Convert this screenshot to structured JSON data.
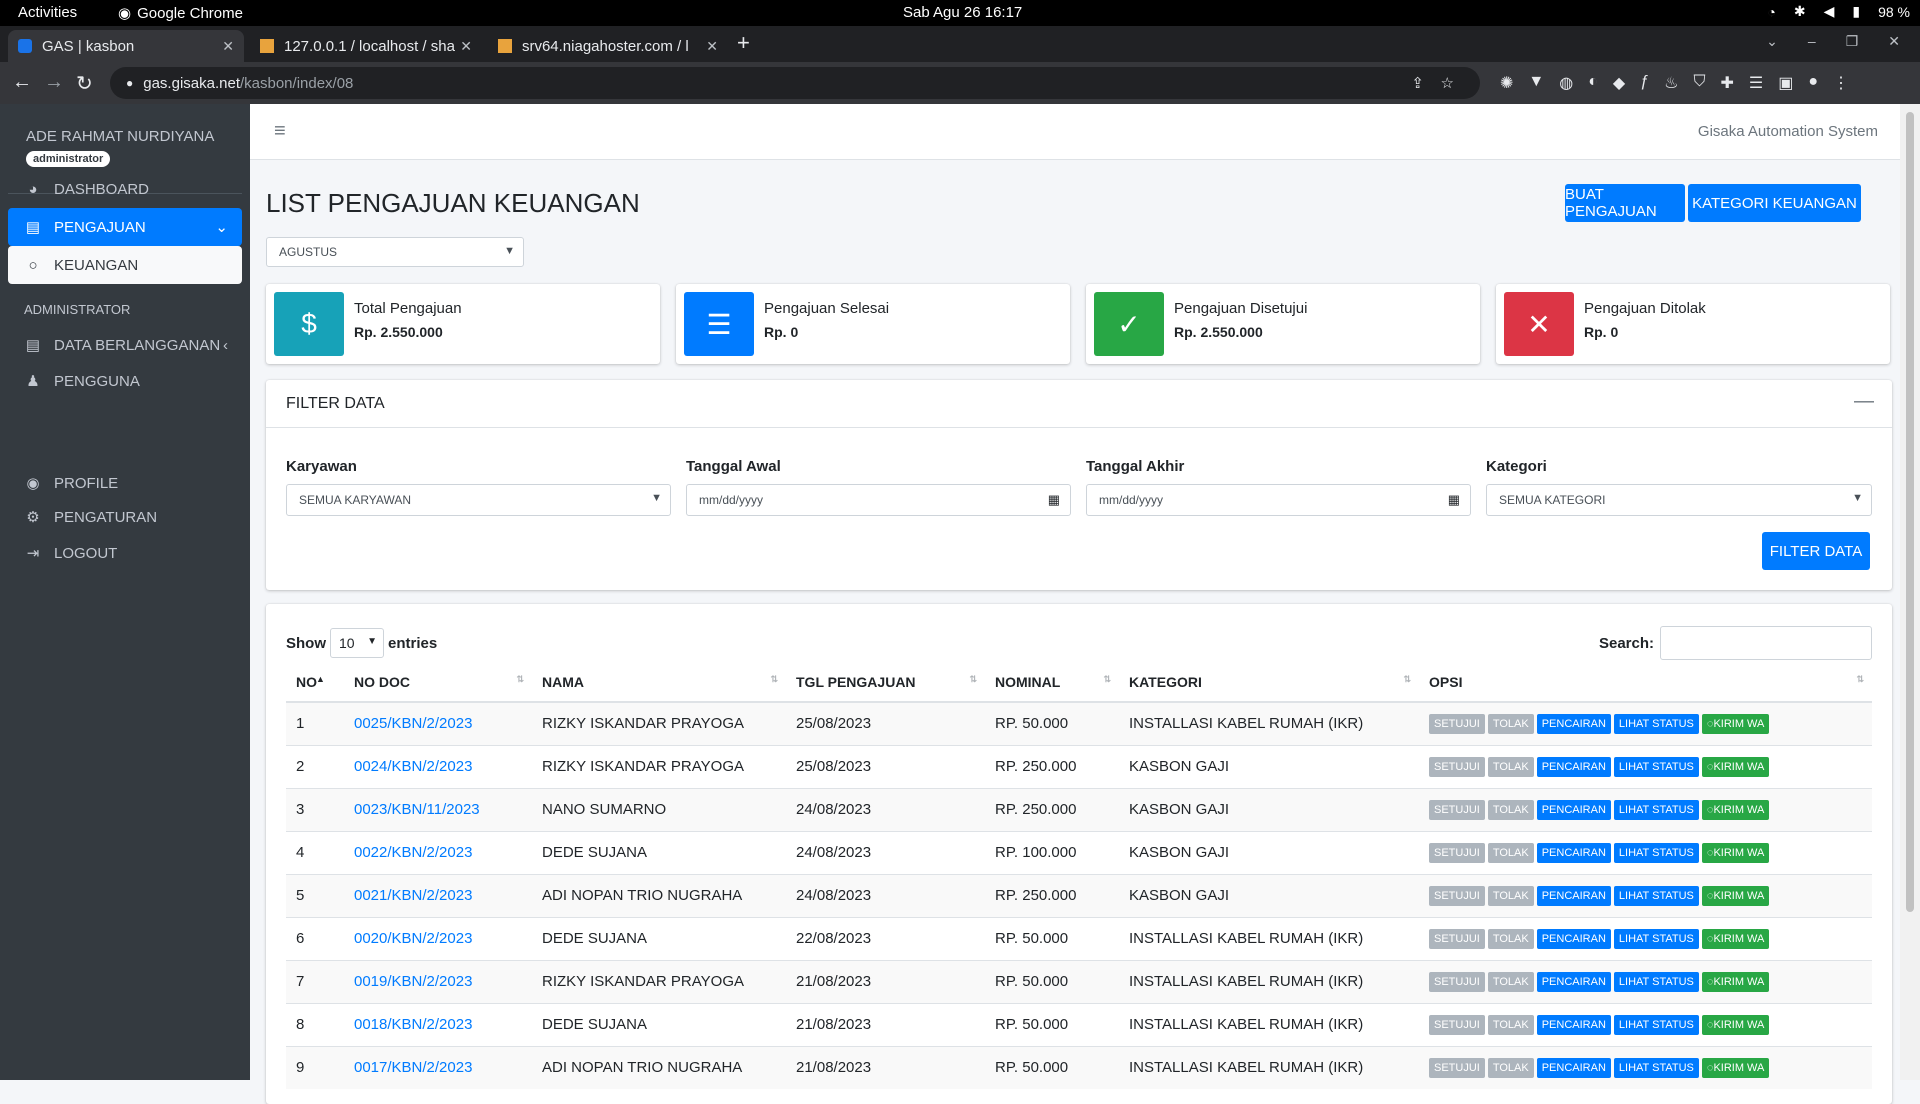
{
  "os": {
    "activities": "Activities",
    "app": "Google Chrome",
    "clock": "Sab Agu 26  16:17",
    "battery": "98 %"
  },
  "browser": {
    "tabs": [
      {
        "title": "GAS | kasbon"
      },
      {
        "title": "127.0.0.1 / localhost / sha"
      },
      {
        "title": "srv64.niagahoster.com / l"
      }
    ],
    "url_host": "gas.gisaka.net",
    "url_path": "/kasbon/index/08"
  },
  "sidebar": {
    "user_name": "ADE RAHMAT NURDIYANA",
    "role": "administrator",
    "items": [
      {
        "label": "DASHBOARD"
      },
      {
        "label": "PENGAJUAN"
      },
      {
        "label": "KEUANGAN"
      }
    ],
    "admin_header": "ADMINISTRATOR",
    "admin_items": [
      {
        "label": "DATA BERLANGGANAN"
      },
      {
        "label": "PENGGUNA"
      }
    ],
    "bottom_items": [
      {
        "label": "PROFILE"
      },
      {
        "label": "PENGATURAN"
      },
      {
        "label": "LOGOUT"
      }
    ]
  },
  "header": {
    "brand": "Gisaka Automation System"
  },
  "page": {
    "title": "LIST PENGAJUAN KEUANGAN",
    "btn_create": "BUAT PENGAJUAN",
    "btn_category": "KATEGORI KEUANGAN",
    "month": "AGUSTUS"
  },
  "stats": [
    {
      "label": "Total Pengajuan",
      "value": "Rp. 2.550.000",
      "color": "#17a2b8"
    },
    {
      "label": "Pengajuan Selesai",
      "value": "Rp. 0",
      "color": "#007bff"
    },
    {
      "label": "Pengajuan Disetujui",
      "value": "Rp. 2.550.000",
      "color": "#28a745"
    },
    {
      "label": "Pengajuan Ditolak",
      "value": "Rp. 0",
      "color": "#dc3545"
    }
  ],
  "filter": {
    "title": "FILTER DATA",
    "karyawan_label": "Karyawan",
    "karyawan_value": "SEMUA KARYAWAN",
    "tgl_awal_label": "Tanggal Awal",
    "tgl_awal_value": "mm/dd/yyyy",
    "tgl_akhir_label": "Tanggal Akhir",
    "tgl_akhir_value": "mm/dd/yyyy",
    "kategori_label": "Kategori",
    "kategori_value": "SEMUA KATEGORI",
    "button": "FILTER DATA"
  },
  "table": {
    "show": "Show",
    "length": "10",
    "entries": "entries",
    "search": "Search:",
    "columns": [
      "NO",
      "NO DOC",
      "NAMA",
      "TGL PENGAJUAN",
      "NOMINAL",
      "KATEGORI",
      "OPSI"
    ],
    "action_labels": [
      "SETUJUI",
      "TOLAK",
      "PENCAIRAN",
      "LIHAT STATUS",
      "KIRIM WA"
    ],
    "rows": [
      {
        "no": "1",
        "doc": "0025/KBN/2/2023",
        "nama": "RIZKY ISKANDAR PRAYOGA",
        "tgl": "25/08/2023",
        "nominal": "RP. 50.000",
        "kategori": "INSTALLASI KABEL RUMAH (IKR)"
      },
      {
        "no": "2",
        "doc": "0024/KBN/2/2023",
        "nama": "RIZKY ISKANDAR PRAYOGA",
        "tgl": "25/08/2023",
        "nominal": "RP. 250.000",
        "kategori": "KASBON GAJI"
      },
      {
        "no": "3",
        "doc": "0023/KBN/11/2023",
        "nama": "NANO SUMARNO",
        "tgl": "24/08/2023",
        "nominal": "RP. 250.000",
        "kategori": "KASBON GAJI"
      },
      {
        "no": "4",
        "doc": "0022/KBN/2/2023",
        "nama": "DEDE SUJANA",
        "tgl": "24/08/2023",
        "nominal": "RP. 100.000",
        "kategori": "KASBON GAJI"
      },
      {
        "no": "5",
        "doc": "0021/KBN/2/2023",
        "nama": "ADI NOPAN TRIO NUGRAHA",
        "tgl": "24/08/2023",
        "nominal": "RP. 250.000",
        "kategori": "KASBON GAJI"
      },
      {
        "no": "6",
        "doc": "0020/KBN/2/2023",
        "nama": "DEDE SUJANA",
        "tgl": "22/08/2023",
        "nominal": "RP. 50.000",
        "kategori": "INSTALLASI KABEL RUMAH (IKR)"
      },
      {
        "no": "7",
        "doc": "0019/KBN/2/2023",
        "nama": "RIZKY ISKANDAR PRAYOGA",
        "tgl": "21/08/2023",
        "nominal": "RP. 50.000",
        "kategori": "INSTALLASI KABEL RUMAH (IKR)"
      },
      {
        "no": "8",
        "doc": "0018/KBN/2/2023",
        "nama": "DEDE SUJANA",
        "tgl": "21/08/2023",
        "nominal": "RP. 50.000",
        "kategori": "INSTALLASI KABEL RUMAH (IKR)"
      },
      {
        "no": "9",
        "doc": "0017/KBN/2/2023",
        "nama": "ADI NOPAN TRIO NUGRAHA",
        "tgl": "21/08/2023",
        "nominal": "RP. 50.000",
        "kategori": "INSTALLASI KABEL RUMAH (IKR)"
      }
    ]
  }
}
